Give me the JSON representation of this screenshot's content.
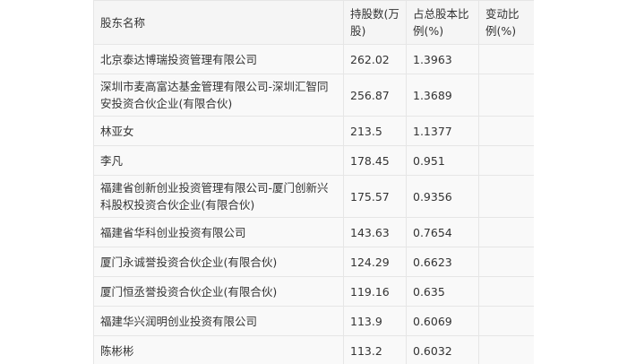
{
  "table": {
    "headers": [
      "股东名称",
      "持股数(万股)",
      "占总股本比例(%)",
      "变动比例(%)"
    ],
    "rows": [
      {
        "name": "北京泰达博瑞投资管理有限公司",
        "shares": "262.02",
        "ratio": "1.3963",
        "change": ""
      },
      {
        "name": "深圳市麦高富达基金管理有限公司-深圳汇智同安投资合伙企业(有限合伙)",
        "shares": "256.87",
        "ratio": "1.3689",
        "change": ""
      },
      {
        "name": "林亚女",
        "shares": "213.5",
        "ratio": "1.1377",
        "change": ""
      },
      {
        "name": "李凡",
        "shares": "178.45",
        "ratio": "0.951",
        "change": ""
      },
      {
        "name": "福建省创新创业投资管理有限公司-厦门创新兴科股权投资合伙企业(有限合伙)",
        "shares": "175.57",
        "ratio": "0.9356",
        "change": ""
      },
      {
        "name": "福建省华科创业投资有限公司",
        "shares": "143.63",
        "ratio": "0.7654",
        "change": ""
      },
      {
        "name": "厦门永诚誉投资合伙企业(有限合伙)",
        "shares": "124.29",
        "ratio": "0.6623",
        "change": ""
      },
      {
        "name": "厦门恒丞誉投资合伙企业(有限合伙)",
        "shares": "119.16",
        "ratio": "0.635",
        "change": ""
      },
      {
        "name": "福建华兴润明创业投资有限公司",
        "shares": "113.9",
        "ratio": "0.6069",
        "change": ""
      },
      {
        "name": "陈彬彬",
        "shares": "113.2",
        "ratio": "0.6032",
        "change": ""
      }
    ]
  }
}
